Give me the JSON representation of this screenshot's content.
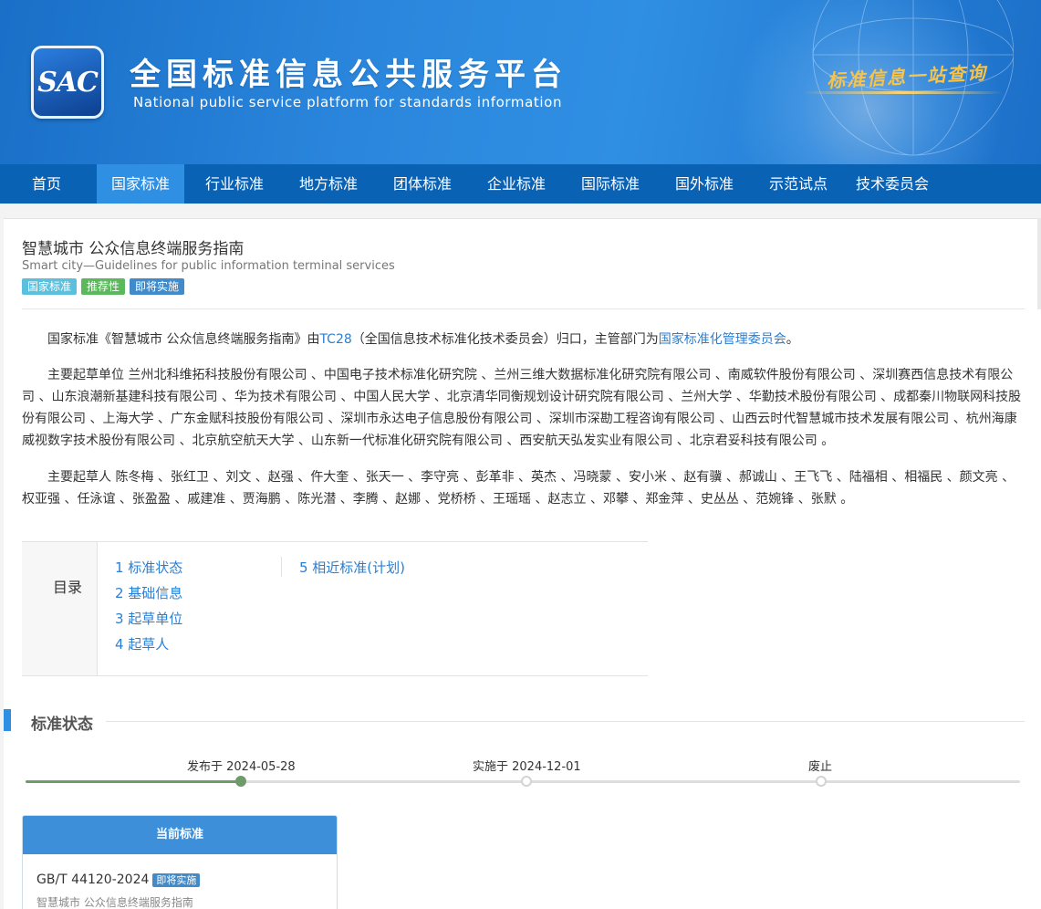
{
  "header": {
    "logo_text": "SAC",
    "title": "全国标准信息公共服务平台",
    "subtitle": "National public service platform  for standards information",
    "slogan": "标准信息一站查询"
  },
  "nav": {
    "items": [
      {
        "label": "首页",
        "active": false
      },
      {
        "label": "国家标准",
        "active": true
      },
      {
        "label": "行业标准",
        "active": false
      },
      {
        "label": "地方标准",
        "active": false
      },
      {
        "label": "团体标准",
        "active": false
      },
      {
        "label": "企业标准",
        "active": false
      },
      {
        "label": "国际标准",
        "active": false
      },
      {
        "label": "国外标准",
        "active": false
      },
      {
        "label": "示范试点",
        "active": false
      },
      {
        "label": "技术委员会",
        "active": false
      }
    ]
  },
  "standard": {
    "title": "智慧城市 公众信息终端服务指南",
    "title_en": "Smart city—Guidelines for public information terminal services",
    "tags": [
      "国家标准",
      "推荐性",
      "即将实施"
    ]
  },
  "intro": {
    "p1_a": "国家标准《智慧城市 公众信息终端服务指南》由",
    "p1_tc": "TC28",
    "p1_b": "（全国信息技术标准化技术委员会）归口，主管部门为",
    "p1_dept": "国家标准化管理委员会",
    "p1_c": "。",
    "drafting_units": "主要起草单位 兰州北科维拓科技股份有限公司 、中国电子技术标准化研究院 、兰州三维大数据标准化研究院有限公司 、南威软件股份有限公司 、深圳赛西信息技术有限公司 、山东浪潮新基建科技有限公司 、华为技术有限公司 、中国人民大学 、北京清华同衡规划设计研究院有限公司 、兰州大学 、华勤技术股份有限公司 、成都秦川物联网科技股份有限公司 、上海大学 、广东金赋科技股份有限公司 、深圳市永达电子信息股份有限公司 、深圳市深勘工程咨询有限公司 、山西云时代智慧城市技术发展有限公司 、杭州海康威视数字技术股份有限公司 、北京航空航天大学 、山东新一代标准化研究院有限公司 、西安航天弘发实业有限公司 、北京君妥科技有限公司 。",
    "drafters": "主要起草人 陈冬梅 、张红卫 、刘文 、赵强 、仵大奎 、张天一 、李守亮 、彭革非 、英杰 、冯晓蒙 、安小米 、赵有骥 、郝诚山 、王飞飞 、陆福相 、相福民 、颜文亮 、权亚强 、任泳谊 、张盈盈 、戚建准 、贾海鹏 、陈光潜 、李腾 、赵娜 、党桥桥 、王瑶瑶 、赵志立 、邓攀 、郑金萍 、史丛丛 、范婉锋 、张默 。"
  },
  "toc": {
    "label": "目录",
    "items": [
      "1  标准状态",
      "2  基础信息",
      "3  起草单位",
      "4  起草人",
      "5  相近标准(计划)"
    ]
  },
  "status_section": {
    "title": "标准状态",
    "timeline": [
      {
        "label": "发布于 2024-05-28",
        "done": true
      },
      {
        "label": "实施于 2024-12-01",
        "done": false
      },
      {
        "label": "废止",
        "done": false
      }
    ]
  },
  "current": {
    "header": "当前标准",
    "code": "GB/T 44120-2024",
    "badge": "即将实施",
    "name": "智慧城市 公众信息终端服务指南"
  },
  "colors": {
    "nav_bg": "#0a62b4",
    "nav_active": "#2f8fe3",
    "link": "#2a7fd4",
    "timeline_done": "#6f9a6a"
  }
}
